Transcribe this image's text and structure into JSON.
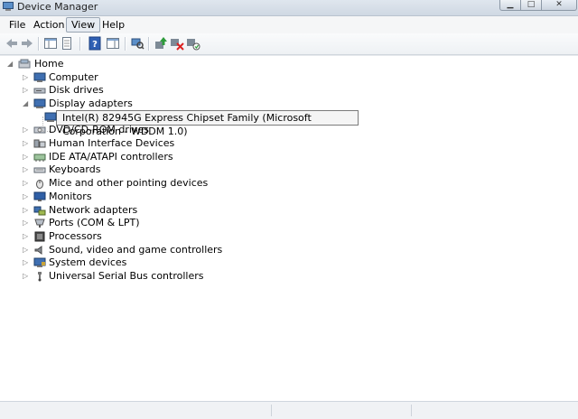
{
  "window": {
    "title": "Device Manager"
  },
  "menu": {
    "file": "File",
    "action": "Action",
    "view": "View",
    "help": "Help"
  },
  "tree": {
    "root": "Home",
    "categories": [
      {
        "label": "Computer",
        "icon": "computer-icon"
      },
      {
        "label": "Disk drives",
        "icon": "disk-drive-icon"
      },
      {
        "label": "Display adapters",
        "icon": "display-adapter-icon"
      },
      {
        "label": "DVD/CD-ROM drives",
        "icon": "dvd-drive-icon"
      },
      {
        "label": "Human Interface Devices",
        "icon": "hid-icon"
      },
      {
        "label": "IDE ATA/ATAPI controllers",
        "icon": "ide-controller-icon"
      },
      {
        "label": "Keyboards",
        "icon": "keyboard-icon"
      },
      {
        "label": "Mice and other pointing devices",
        "icon": "mouse-icon"
      },
      {
        "label": "Monitors",
        "icon": "monitor-icon"
      },
      {
        "label": "Network adapters",
        "icon": "network-adapter-icon"
      },
      {
        "label": "Ports (COM & LPT)",
        "icon": "port-icon"
      },
      {
        "label": "Processors",
        "icon": "processor-icon"
      },
      {
        "label": "Sound, video and game controllers",
        "icon": "sound-icon"
      },
      {
        "label": "System devices",
        "icon": "system-device-icon"
      },
      {
        "label": "Universal Serial Bus controllers",
        "icon": "usb-icon"
      }
    ],
    "display_child": "Intel(R) 82945G Express Chipset Family (Microsoft Corporation - WDDM 1.0)"
  }
}
